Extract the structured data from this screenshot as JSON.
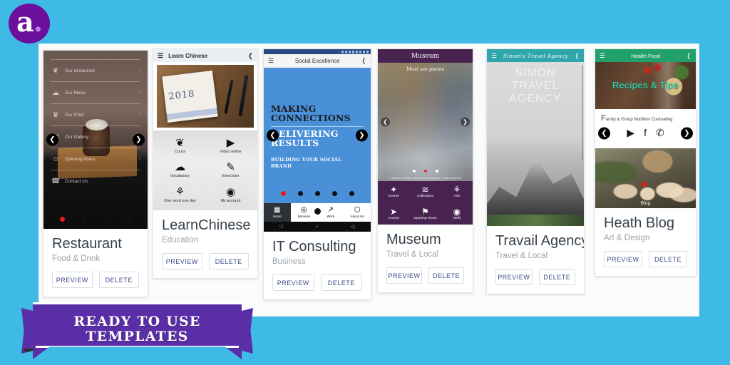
{
  "brand": {
    "logo_text": "a",
    "logo_dot": "."
  },
  "ribbon": {
    "line1": "READY TO USE",
    "line2": "TEMPLATES",
    "color": "#5a2ea6"
  },
  "background_color": "#3fb9e5",
  "buttons": {
    "preview": "PREVIEW",
    "delete": "DELETE"
  },
  "cards": [
    {
      "id": "restaurant",
      "title": "Restaurant",
      "category": "Food & Drink",
      "menu": [
        {
          "label": "Our restaurant",
          "icon": "leaf-icon",
          "glyph": "❦"
        },
        {
          "label": "Our Menu",
          "icon": "cloud-icon",
          "glyph": "☁"
        },
        {
          "label": "Our Chef",
          "icon": "trophy-icon",
          "glyph": "♛"
        },
        {
          "label": "Our Gallery",
          "icon": "camera-icon",
          "glyph": "▣"
        },
        {
          "label": "Opening hours",
          "icon": "smiley-icon",
          "glyph": "☺"
        },
        {
          "label": "Contact Us",
          "icon": "phone-icon",
          "glyph": "☎"
        }
      ],
      "dots": 4,
      "active_dot": 0
    },
    {
      "id": "learnchinese",
      "title": "LearnChinese",
      "category": "Education",
      "appbar_title": "Learn Chinese",
      "hero_text": "2018",
      "grid": [
        {
          "label": "Cours",
          "icon": "leaf-icon",
          "glyph": "❦"
        },
        {
          "label": "Video online",
          "icon": "youtube-icon",
          "glyph": "▶"
        },
        {
          "label": "Vocabulary",
          "icon": "soundcloud-icon",
          "glyph": "☁"
        },
        {
          "label": "Exercises",
          "icon": "pencil-icon",
          "glyph": "✎"
        },
        {
          "label": "One word one day",
          "icon": "plant-icon",
          "glyph": "⚘"
        },
        {
          "label": "My account",
          "icon": "user-icon",
          "glyph": "◉"
        }
      ]
    },
    {
      "id": "itconsulting",
      "title": "IT Consulting",
      "category": "Business",
      "appbar_title": "Social Excellence",
      "headline1": "MAKING CONNECTIONS",
      "headline2": "DELIVERING RESULTS",
      "subline": "BUILDING YOUR SOCIAL BRAND",
      "dots": 5,
      "active_dot": 0,
      "tabs": [
        {
          "label": "Home",
          "icon": "grid-icon",
          "glyph": "▦",
          "active": true
        },
        {
          "label": "Services",
          "icon": "lifebuoy-icon",
          "glyph": "◎",
          "active": false
        },
        {
          "label": "Work",
          "icon": "chart-icon",
          "glyph": "↗",
          "active": false
        },
        {
          "label": "About Us",
          "icon": "badge-icon",
          "glyph": "⬡",
          "active": false
        }
      ],
      "android_nav": [
        "□",
        "○",
        "◁"
      ]
    },
    {
      "id": "museum",
      "title": "Museum",
      "category": "Travel & Local",
      "appbar_title": "Museum",
      "caption": "Must see pieces",
      "credit": "© Musée d'Orsay / Musée de l'Orangerie - Artist reserved",
      "dots": 3,
      "active_dot": 1,
      "grid": [
        {
          "label": "Events",
          "icon": "fireworks-icon",
          "glyph": "✦"
        },
        {
          "label": "Collections",
          "icon": "wave-icon",
          "glyph": "≋"
        },
        {
          "label": "Arts",
          "icon": "plant-icon",
          "glyph": "⚘"
        },
        {
          "label": "Access",
          "icon": "navigation-icon",
          "glyph": "➤"
        },
        {
          "label": "Opening Hours",
          "icon": "flag-icon",
          "glyph": "⚑"
        },
        {
          "label": "Tarifs",
          "icon": "coin-icon",
          "glyph": "◉"
        }
      ]
    },
    {
      "id": "travail",
      "title": "Travail Agency",
      "category": "Travel & Local",
      "appbar_title": "Simon's Travel Agency",
      "hero_lines": [
        "SIMON",
        "TRAVEL",
        "AGENCY"
      ]
    },
    {
      "id": "heath",
      "title": "Heath Blog",
      "category": "Art & Design",
      "appbar_title": "Health Food",
      "hero_caption": "Recipes & Tips",
      "mid_text_first": "F",
      "mid_text_rest": "amily & Group Nutrition Counseling",
      "social": [
        {
          "label": "youtube-icon",
          "glyph": "▶"
        },
        {
          "label": "facebook-icon",
          "glyph": "f"
        },
        {
          "label": "twitter-icon",
          "glyph": "✆"
        }
      ],
      "photo_caption": "Blog"
    }
  ]
}
